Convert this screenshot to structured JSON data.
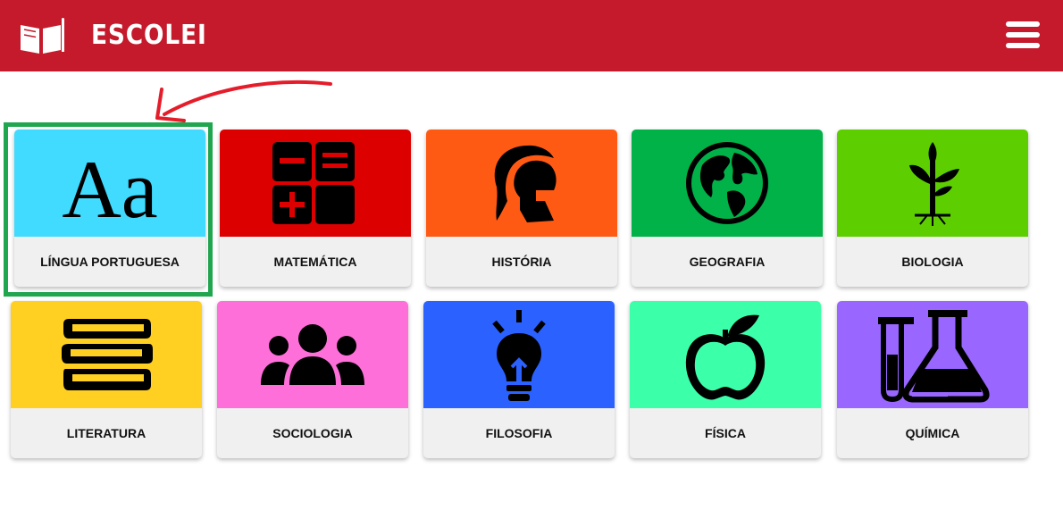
{
  "header": {
    "brand": "ESCOLEI",
    "logo_icon": "book-icon",
    "menu_icon": "hamburger-menu-icon",
    "background_color": "#c41a2c"
  },
  "annotation": {
    "arrow_color": "#e51d2b",
    "highlight_color": "#21a650"
  },
  "subjects": [
    {
      "label": "LÍNGUA PORTUGUESA",
      "icon": "letters-aa-icon",
      "color": "#40dbff",
      "glyph": "Aa"
    },
    {
      "label": "MATEMÁTICA",
      "icon": "calculator-icon",
      "color": "#dd0000"
    },
    {
      "label": "HISTÓRIA",
      "icon": "spartan-helmet-icon",
      "color": "#ff5a14"
    },
    {
      "label": "GEOGRAFIA",
      "icon": "globe-icon",
      "color": "#00b248"
    },
    {
      "label": "BIOLOGIA",
      "icon": "plant-sprout-icon",
      "color": "#5dcf00"
    },
    {
      "label": "LITERATURA",
      "icon": "stacked-books-icon",
      "color": "#ffcf22"
    },
    {
      "label": "SOCIOLOGIA",
      "icon": "people-group-icon",
      "color": "#ff6fd9"
    },
    {
      "label": "FILOSOFIA",
      "icon": "lightbulb-icon",
      "color": "#2b62ff"
    },
    {
      "label": "FÍSICA",
      "icon": "apple-icon",
      "color": "#3cffaa"
    },
    {
      "label": "QUÍMICA",
      "icon": "chemistry-flask-icon",
      "color": "#9966ff"
    }
  ]
}
